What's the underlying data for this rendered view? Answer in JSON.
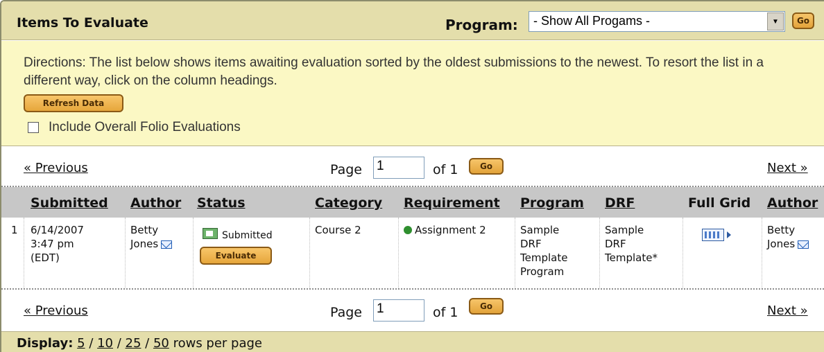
{
  "header": {
    "title": "Items To Evaluate",
    "program_label": "Program:",
    "program_selected": "- Show All Progams -",
    "go_label": "Go"
  },
  "directions": {
    "text": "Directions: The list below shows items awaiting evaluation sorted by the oldest submissions to the newest. To resort the list in a different way, click on the column headings.",
    "refresh_label": "Refresh Data",
    "include_label": "Include Overall Folio Evaluations"
  },
  "pager": {
    "previous": "« Previous",
    "page_label": "Page",
    "page_value": "1",
    "of_label": "of 1",
    "go_label": "Go",
    "next": "Next »"
  },
  "table": {
    "columns": [
      "Submitted",
      "Author",
      "Status",
      "Category",
      "Requirement",
      "Program",
      "DRF",
      "Full Grid",
      "Author"
    ],
    "rows": [
      {
        "index": "1",
        "submitted": [
          "6/14/2007",
          "3:47 pm",
          "(EDT)"
        ],
        "author": [
          "Betty",
          "Jones"
        ],
        "status": "Submitted",
        "evaluate_label": "Evaluate",
        "category": "Course 2",
        "requirement": "Assignment 2",
        "program": [
          "Sample",
          "DRF",
          "Template",
          "Program"
        ],
        "drf": [
          "Sample",
          "DRF",
          "Template*"
        ],
        "author2": [
          "Betty",
          "Jones"
        ]
      }
    ]
  },
  "footer": {
    "display_label": "Display:",
    "options": [
      "5",
      "10",
      "25",
      "50"
    ],
    "suffix": "rows per page"
  }
}
